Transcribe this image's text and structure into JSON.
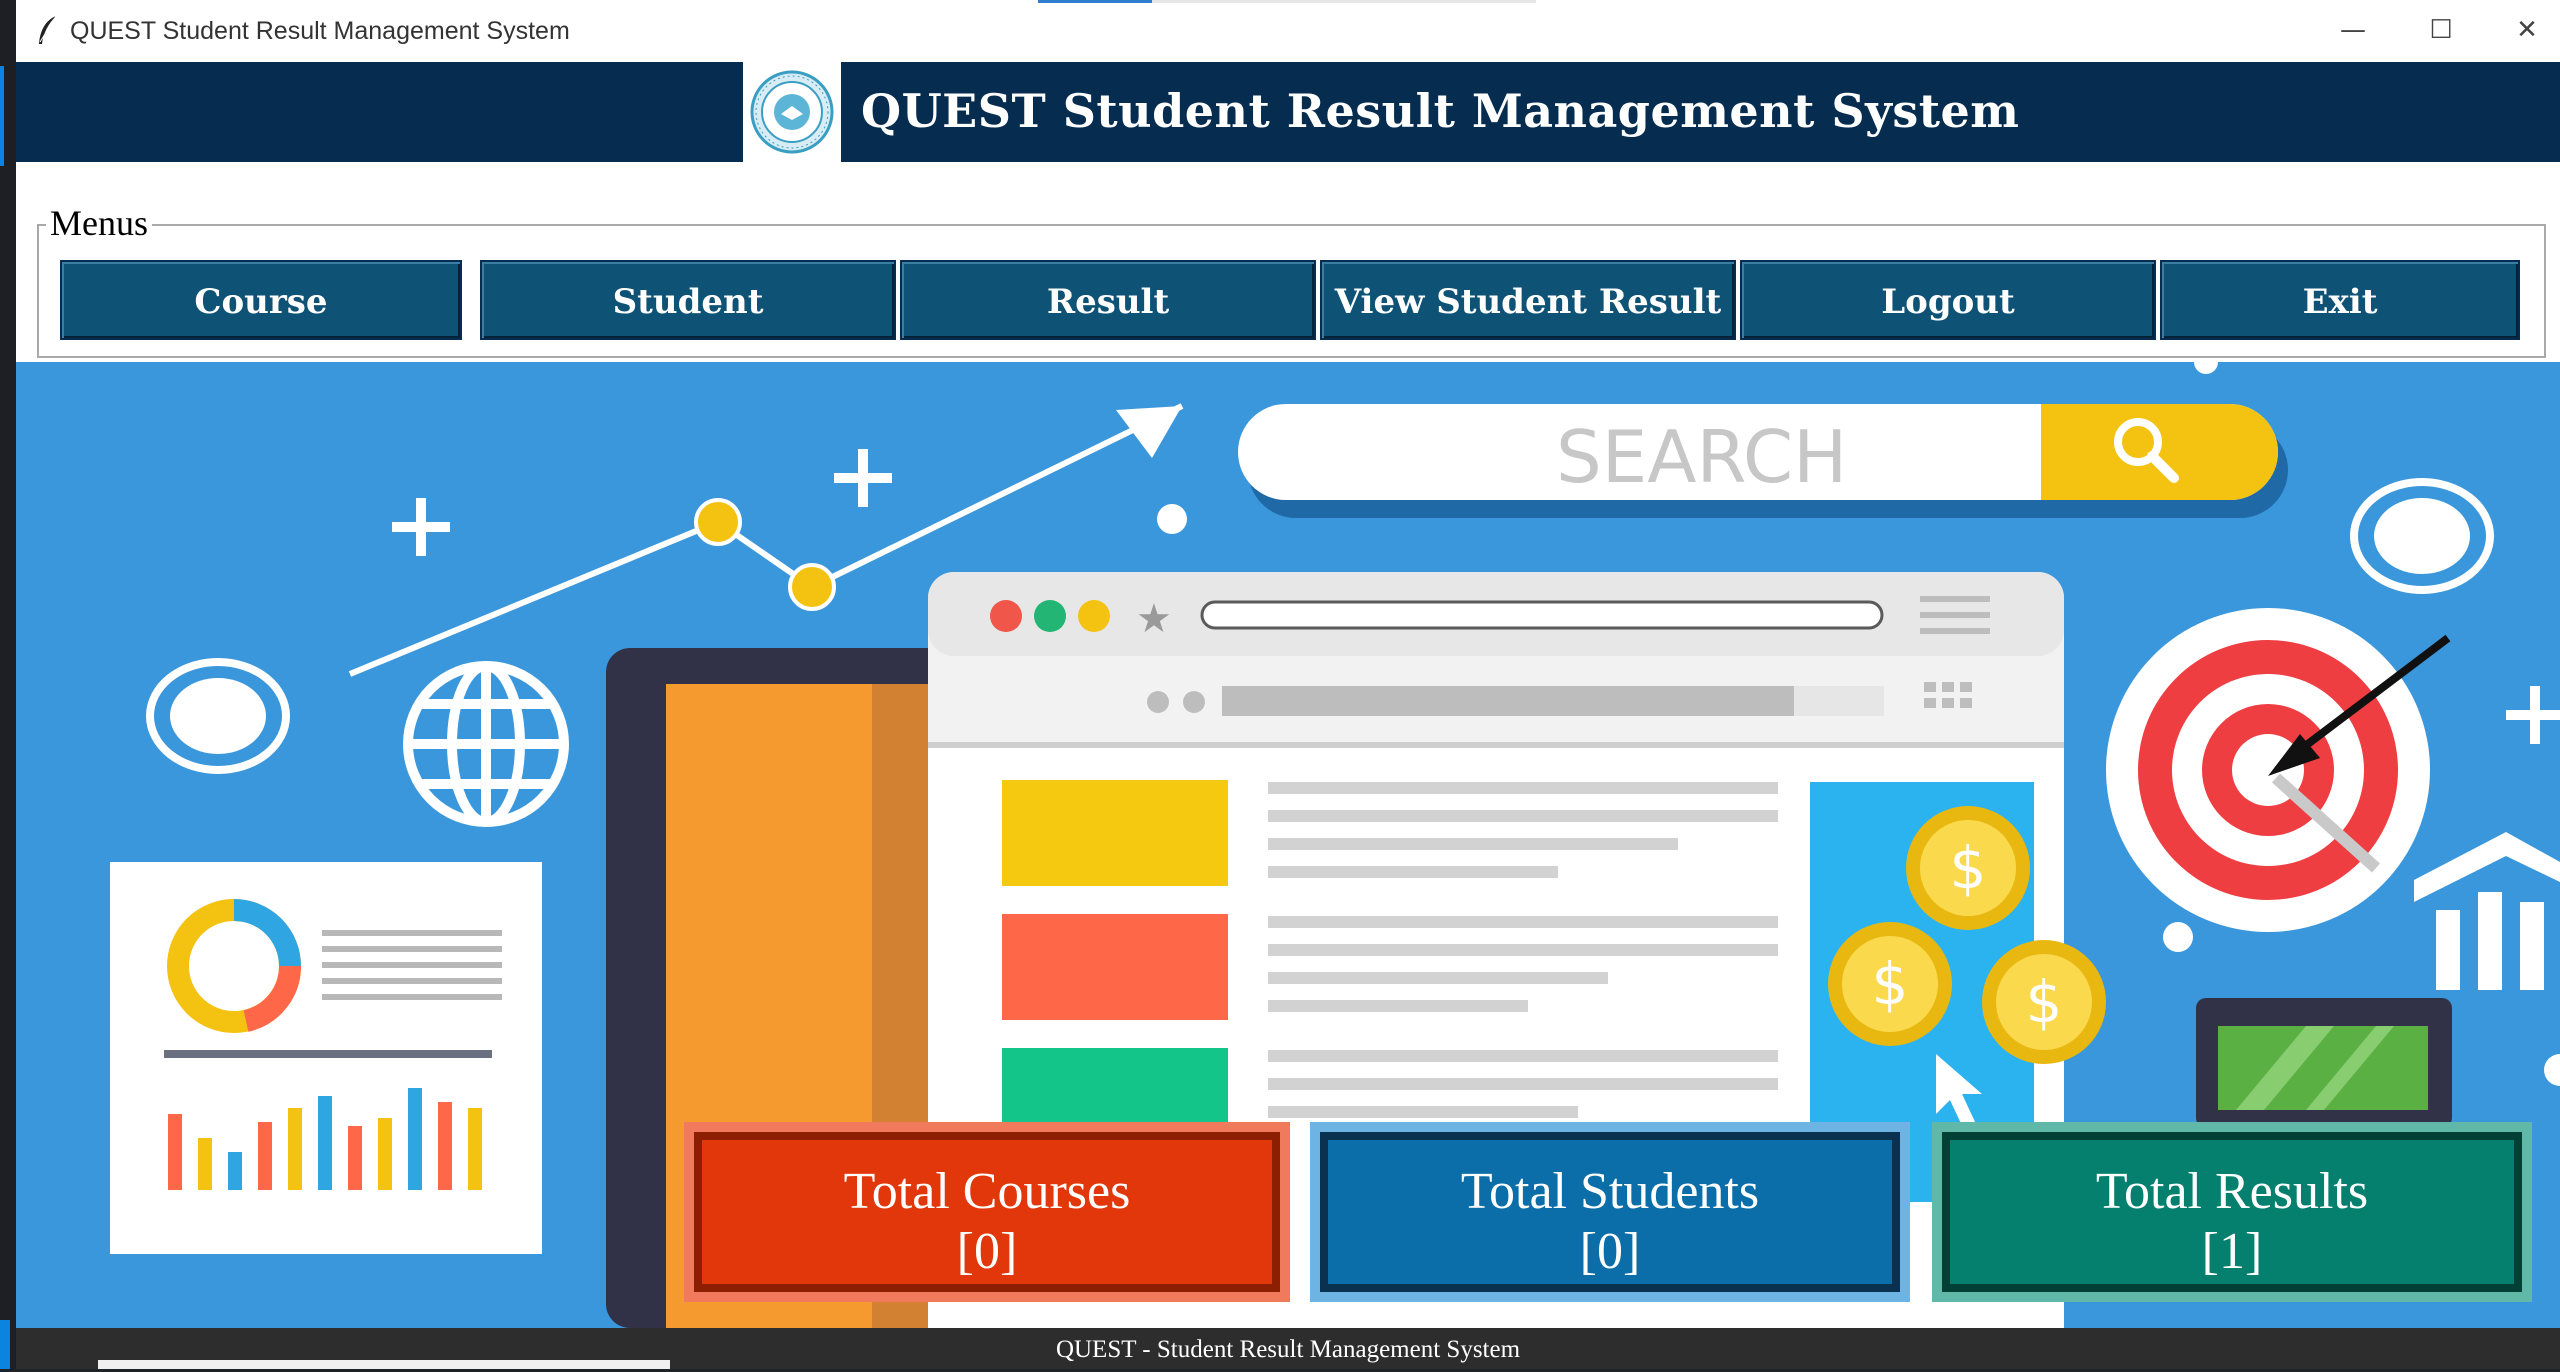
{
  "window": {
    "title": "QUEST Student Result Management System",
    "controls": {
      "minimize": "—",
      "maximize": "☐",
      "close": "✕"
    }
  },
  "header": {
    "title": "QUEST Student Result Management System"
  },
  "menus": {
    "legend": "Menus",
    "buttons": [
      "Course",
      "Student",
      "Result",
      "View Student Result",
      "Logout",
      "Exit"
    ]
  },
  "banner": {
    "search_text": "SEARCH",
    "dollar": "$"
  },
  "stats": {
    "courses": {
      "label": "Total Courses",
      "value": "[0]"
    },
    "students": {
      "label": "Total Students",
      "value": "[0]"
    },
    "results": {
      "label": "Total Results",
      "value": "[1]"
    }
  },
  "footer": {
    "text": "QUEST - Student Result Management System"
  },
  "colors": {
    "header_bg": "#062d4f",
    "menu_button": "#0e5275",
    "banner_bg": "#3b97db",
    "courses": "#e2370b",
    "students": "#0b6ea8",
    "results": "#06806e"
  }
}
